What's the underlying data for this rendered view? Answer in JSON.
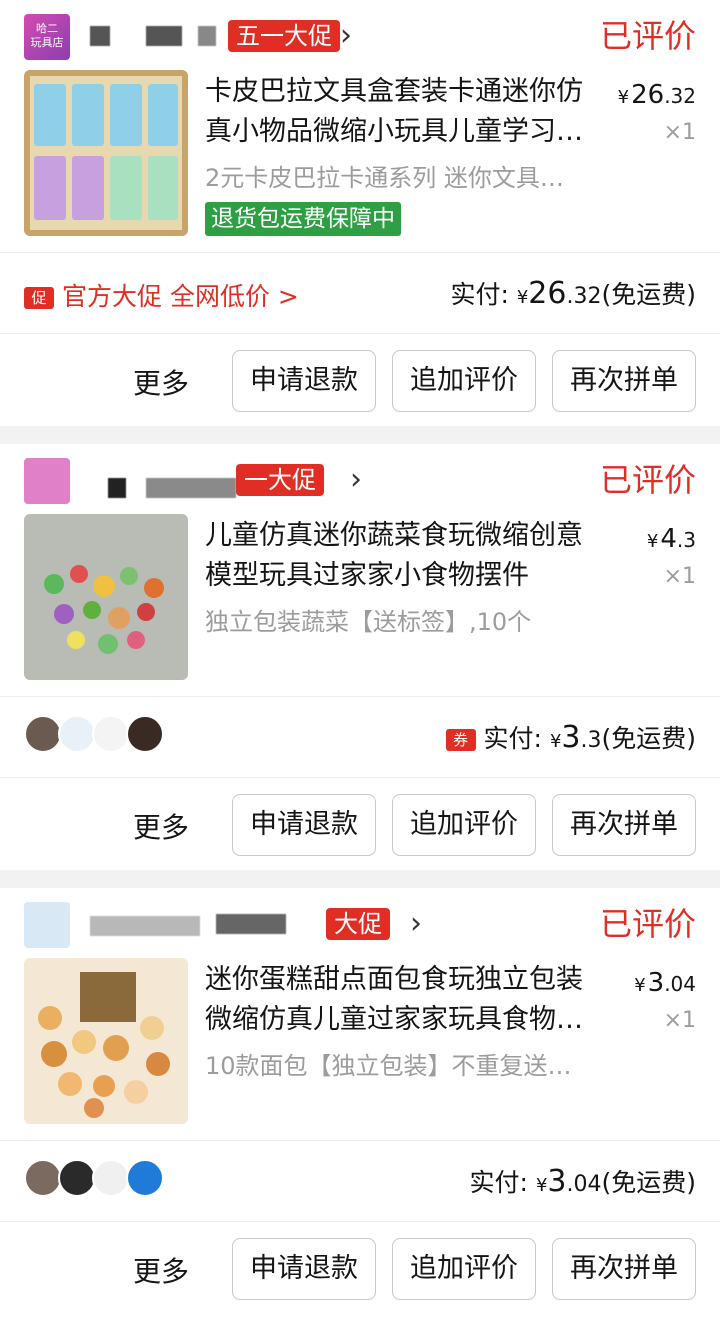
{
  "orders": [
    {
      "promo_tag": "五一大促",
      "status": "已评价",
      "title": "卡皮巴拉文具盒套装卡通迷你仿真小物品微缩小玩具儿童学习…",
      "price_symbol": "¥",
      "price_int": "26",
      "price_dec": ".32",
      "qty": "×1",
      "spec": "2元卡皮巴拉卡通系列 迷你文具…",
      "guarantee": "退货包运费保障中",
      "promo_icon": "促",
      "promo_link": "官方大促 全网低价 >",
      "paid_label": "实付:",
      "paid_symbol": "¥",
      "paid_int": "26",
      "paid_dec": ".32",
      "paid_note": "(免运费)",
      "more": "更多",
      "btn_refund": "申请退款",
      "btn_review": "追加评价",
      "btn_reorder": "再次拼单"
    },
    {
      "promo_tag": "一大促",
      "status": "已评价",
      "title": "儿童仿真迷你蔬菜食玩微缩创意模型玩具过家家小食物摆件",
      "price_symbol": "¥",
      "price_int": "4",
      "price_dec": ".3",
      "qty": "×1",
      "spec": "独立包装蔬菜【送标签】,10个",
      "coupon_icon": "券",
      "paid_label": "实付:",
      "paid_symbol": "¥",
      "paid_int": "3",
      "paid_dec": ".3",
      "paid_note": "(免运费)",
      "more": "更多",
      "btn_refund": "申请退款",
      "btn_review": "追加评价",
      "btn_reorder": "再次拼单"
    },
    {
      "promo_tag": "大促",
      "status": "已评价",
      "title": "迷你蛋糕甜点面包食玩独立包装微缩仿真儿童过家家玩具食物…",
      "price_symbol": "¥",
      "price_int": "3",
      "price_dec": ".04",
      "qty": "×1",
      "spec": "10款面包【独立包装】不重复送…",
      "paid_label": "实付:",
      "paid_symbol": "¥",
      "paid_int": "3",
      "paid_dec": ".04",
      "paid_note": "(免运费)",
      "more": "更多",
      "btn_refund": "申请退款",
      "btn_review": "追加评价",
      "btn_reorder": "再次拼单"
    }
  ],
  "shop_logo_text": "哈二\n玩具店",
  "colors": {
    "accent": "#e02e24",
    "green": "#2ea043",
    "text": "#151516",
    "muted": "#9c9c9c",
    "divider": "#f2f2f2"
  }
}
